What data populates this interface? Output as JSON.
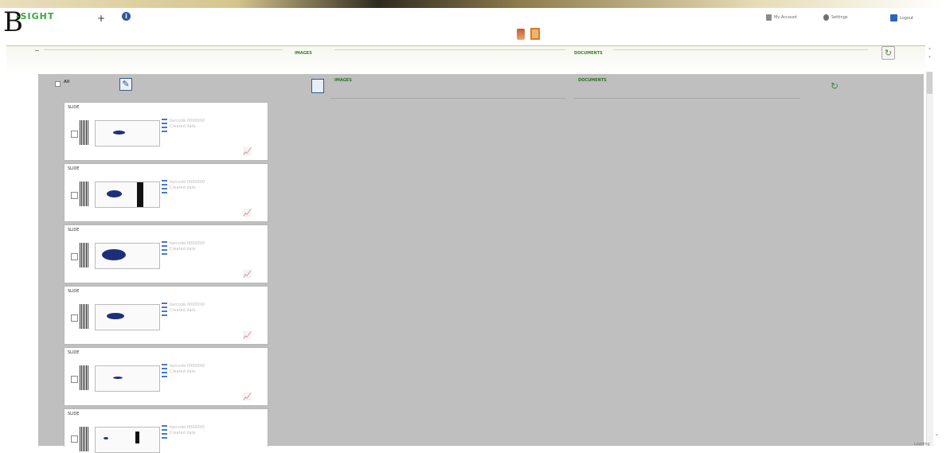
{
  "header": {
    "logo_initial": "B",
    "logo_word": "-SIGHT",
    "logo_plus": "+",
    "info_glyph": "i",
    "user_link": "My Account",
    "settings_link": "Settings",
    "logout_link": "Logout"
  },
  "outer_tabs": [
    {
      "label": "IMAGES"
    },
    {
      "label": "DOCUMENTS"
    }
  ],
  "panel": {
    "select_all_label": "All",
    "inner_tabs": [
      {
        "label": "IMAGES"
      },
      {
        "label": "DOCUMENTS"
      }
    ]
  },
  "cards": [
    {
      "title": "SLIDE",
      "meta": [
        "barcode 0000000",
        "Created date"
      ]
    },
    {
      "title": "SLIDE",
      "meta": [
        "barcode 0000000",
        "Created date"
      ]
    },
    {
      "title": "SLIDE",
      "meta": [
        "barcode 0000000",
        "Created date"
      ]
    },
    {
      "title": "SLIDE",
      "meta": [
        "barcode 0000000",
        "Created date"
      ]
    },
    {
      "title": "SLIDE",
      "meta": [
        "barcode 0000000",
        "Created date"
      ]
    },
    {
      "title": "SLIDE",
      "meta": [
        "barcode 0000000",
        "Created date"
      ]
    }
  ],
  "footer": {
    "label": "Loading"
  },
  "colors": {
    "accent_green": "#38a83f",
    "panel_gray": "#bfbfbf",
    "brand_blue": "#2f57a4"
  }
}
